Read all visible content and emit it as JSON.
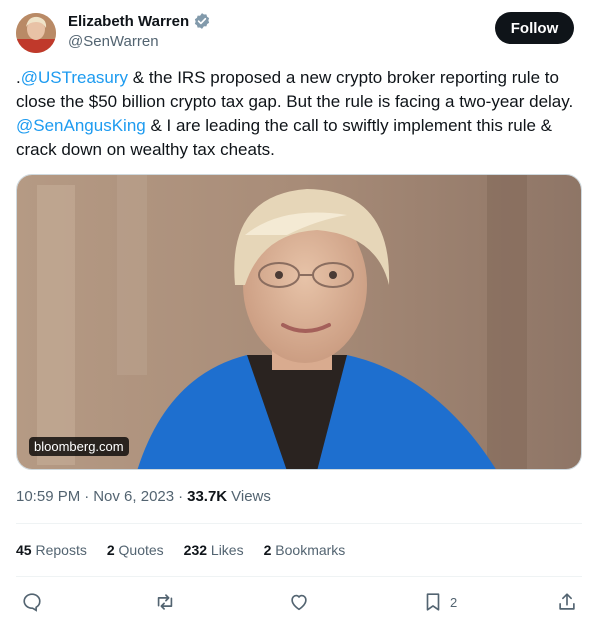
{
  "author": {
    "display_name": "Elizabeth Warren",
    "handle": "@SenWarren",
    "verified_icon": "verified-badge-icon"
  },
  "follow_button": {
    "label": "Follow"
  },
  "tweet": {
    "prefix": ".",
    "mention_1": "@USTreasury",
    "text_1": " & the IRS proposed a new crypto broker reporting rule to close the $50 billion crypto tax gap. But the rule is facing a two-year delay. ",
    "mention_2": "@SenAngusKing",
    "text_2": " & I are leading the call to swiftly implement this rule & crack down on wealthy tax cheats."
  },
  "media": {
    "source_label": "bloomberg.com"
  },
  "meta": {
    "time": "10:59 PM",
    "sep1": "·",
    "date": "Nov 6, 2023",
    "sep2": "·",
    "views_count": "33.7K",
    "views_label": "Views"
  },
  "stats": {
    "reposts_count": "45",
    "reposts_label": "Reposts",
    "quotes_count": "2",
    "quotes_label": "Quotes",
    "likes_count": "232",
    "likes_label": "Likes",
    "bookmarks_count": "2",
    "bookmarks_label": "Bookmarks"
  },
  "actions": {
    "bookmark_count": "2"
  },
  "colors": {
    "text": "#0f1419",
    "secondary": "#536471",
    "link": "#1d9bf0",
    "follow_bg": "#0f1419",
    "divider": "#eff3f4"
  }
}
